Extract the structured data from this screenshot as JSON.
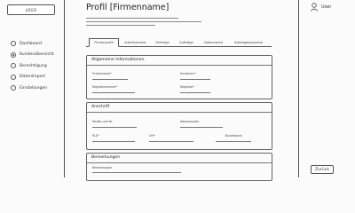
{
  "logo": {
    "text": "LOGO"
  },
  "user": {
    "label": "User",
    "icon": "user-icon"
  },
  "sidebar": {
    "items": [
      {
        "label": "Dashboard",
        "active": false
      },
      {
        "label": "Kundenübersicht",
        "active": true
      },
      {
        "label": "Berechtigung",
        "active": false
      },
      {
        "label": "Datenimport",
        "active": false
      },
      {
        "label": "Einstellungen",
        "active": false
      }
    ]
  },
  "page": {
    "title": "Profil [Firmenname]"
  },
  "tabs": [
    {
      "label": "Firmenprofil",
      "active": true
    },
    {
      "label": "Arbeitnehmer",
      "active": false
    },
    {
      "label": "Verträge",
      "active": false
    },
    {
      "label": "Aufträge",
      "active": false
    },
    {
      "label": "Dokumente",
      "active": false
    },
    {
      "label": "Arbeitgeberportal",
      "active": false
    }
  ],
  "sections": {
    "general": {
      "title": "Allgemeine Informationen",
      "fields": [
        "Firmenname*",
        "Kundennr.*",
        "Registernummer*",
        "Registrar*"
      ]
    },
    "address": {
      "title": "Anschrift",
      "fields": [
        "Straße und Nr.",
        "Adresszusatz",
        "PLZ*",
        "Ort*",
        "Bundesland"
      ]
    },
    "notes": {
      "title": "Bemerkungen",
      "fields": [
        "Bemerkungen"
      ]
    }
  },
  "actions": {
    "back_label": "Zurück"
  }
}
